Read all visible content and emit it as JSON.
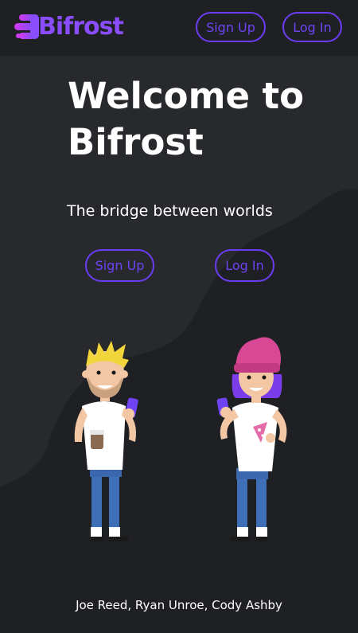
{
  "brand": {
    "name": "Bifrost",
    "color": "#8a4dfc"
  },
  "nav": {
    "signup_label": "Sign Up",
    "login_label": "Log In"
  },
  "hero": {
    "title_line1": "Welcome to",
    "title_line2": "Bifrost",
    "subtitle": "The bridge between worlds",
    "signup_label": "Sign Up",
    "login_label": "Log In"
  },
  "footer": {
    "credits": "Joe Reed, Ryan Unroe, Cody Ashby"
  },
  "colors": {
    "background": "#27292d",
    "navbar": "#1f2024",
    "wave": "#1f2024",
    "accent": "#6b3df2"
  }
}
